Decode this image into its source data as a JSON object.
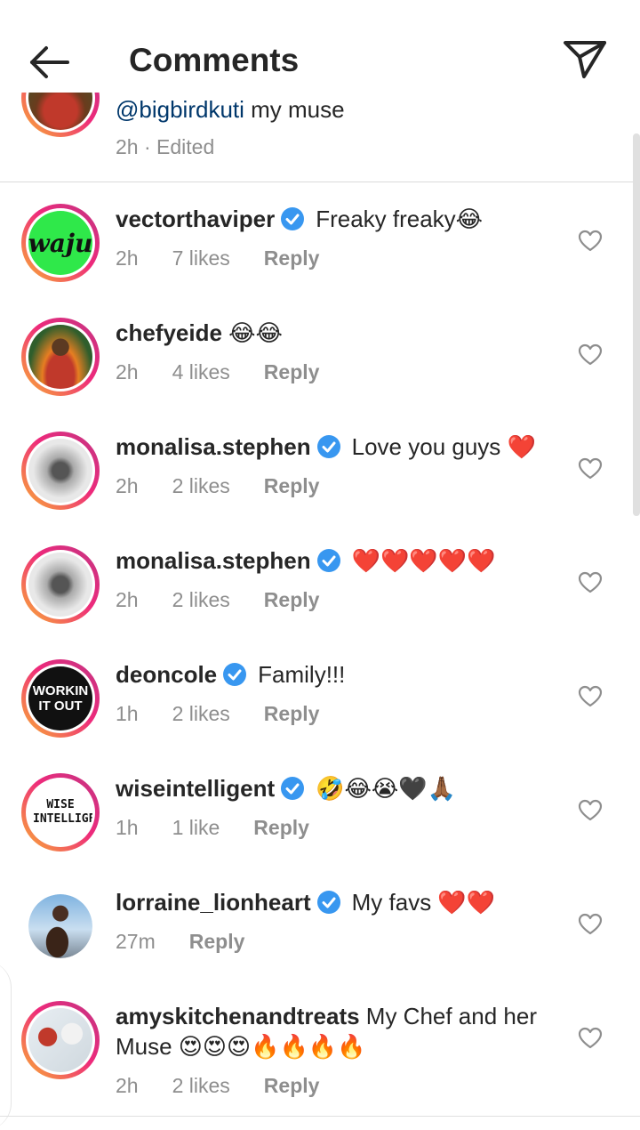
{
  "header": {
    "title": "Comments",
    "back_icon": "arrow-left-icon",
    "send_icon": "paper-plane-icon"
  },
  "partial_comment": {
    "mention": "@bigbirdkuti",
    "text": " my muse",
    "time": "2h",
    "edited": "· Edited"
  },
  "comments": [
    {
      "user": "vectorthaviper",
      "verified": true,
      "text": "Freaky freaky😂",
      "time": "2h",
      "likes": "7 likes",
      "reply": "Reply",
      "avatar": "waju"
    },
    {
      "user": "chefyeide",
      "verified": false,
      "text": " 😂😂",
      "time": "2h",
      "likes": "4 likes",
      "reply": "Reply",
      "avatar": "chef-photo"
    },
    {
      "user": "monalisa.stephen",
      "verified": true,
      "text": "Love you guys ❤️",
      "time": "2h",
      "likes": "2 likes",
      "reply": "Reply",
      "avatar": "water-gurl"
    },
    {
      "user": "monalisa.stephen",
      "verified": true,
      "text": "❤️❤️❤️❤️❤️",
      "time": "2h",
      "likes": "2 likes",
      "reply": "Reply",
      "avatar": "water-gurl"
    },
    {
      "user": "deoncole",
      "verified": true,
      "text": "Family!!!",
      "time": "1h",
      "likes": "2 likes",
      "reply": "Reply",
      "avatar": "workin-it-out",
      "avatar_text": "WORKIN IT OUT"
    },
    {
      "user": "wiseintelligent",
      "verified": true,
      "text": "🤣😂😭🖤🙏🏾",
      "time": "1h",
      "likes": "1 like",
      "reply": "Reply",
      "avatar": "wise-logo",
      "avatar_text": "WISE INTELLIGENT"
    },
    {
      "user": "lorraine_lionheart",
      "verified": true,
      "text": "My favs ❤️❤️",
      "time": "27m",
      "likes": "",
      "reply": "Reply",
      "avatar": "lorraine-photo"
    },
    {
      "user": "amyskitchenandtreats",
      "verified": false,
      "text": " My Chef and her Muse 😍😍😍🔥🔥🔥🔥",
      "time": "2h",
      "likes": "2 likes",
      "reply": "Reply",
      "avatar": "cookies-school"
    }
  ],
  "colors": {
    "text": "#262626",
    "meta": "#8e8e8e",
    "verified": "#3897f0",
    "mention": "#00376b"
  }
}
